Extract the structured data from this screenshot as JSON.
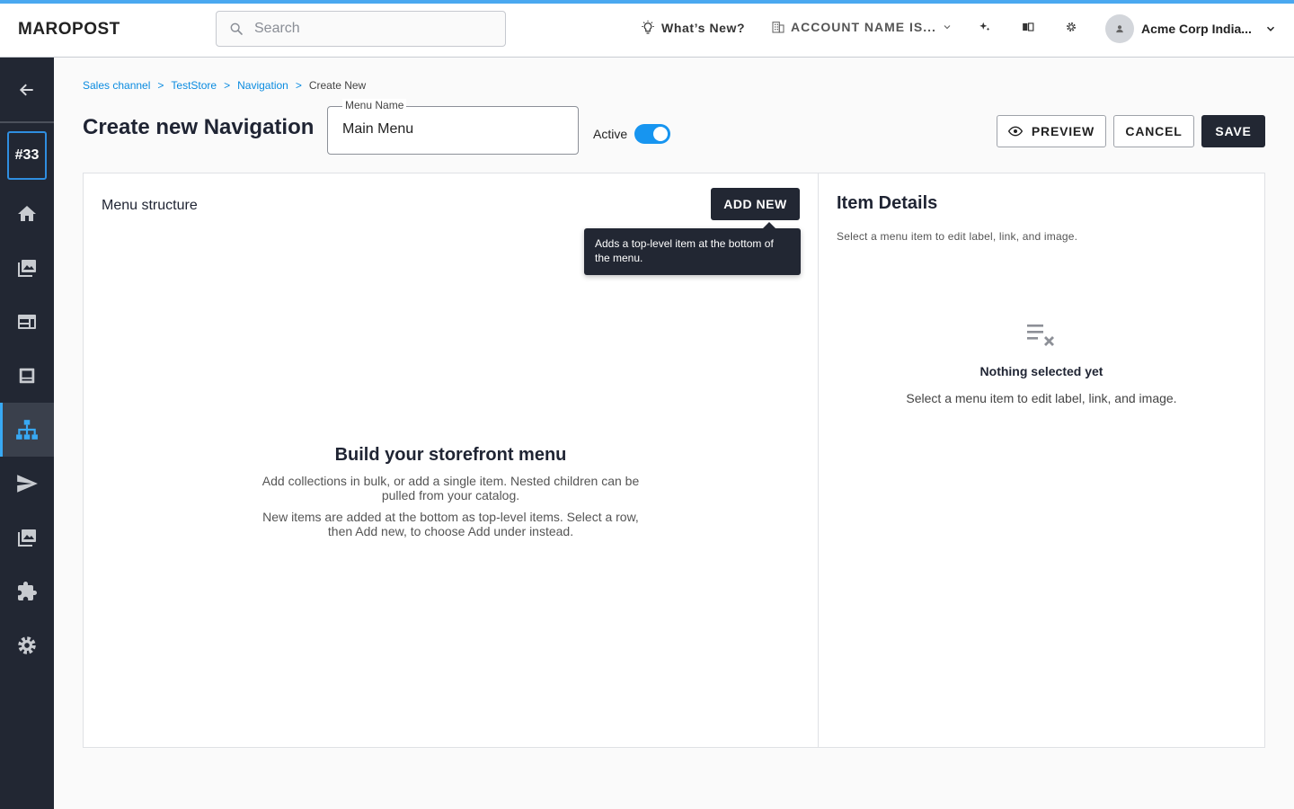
{
  "header": {
    "logo": "MAROPOST",
    "search_placeholder": "Search",
    "whats_new": "What’s New?",
    "account_name": "ACCOUNT NAME IS...",
    "user_name": "Acme Corp India..."
  },
  "sidebar": {
    "badge": "#33",
    "items": [
      {
        "icon": "home-icon"
      },
      {
        "icon": "gallery-icon"
      },
      {
        "icon": "web-icon"
      },
      {
        "icon": "list-icon"
      },
      {
        "icon": "sitemap-icon",
        "active": true
      },
      {
        "icon": "send-icon"
      },
      {
        "icon": "image-icon"
      },
      {
        "icon": "extension-icon"
      },
      {
        "icon": "settings-icon"
      }
    ]
  },
  "breadcrumb": {
    "items": [
      "Sales channel",
      "TestStore",
      "Navigation"
    ],
    "separator": ">",
    "current": "Create New"
  },
  "page": {
    "title": "Create new Navigation",
    "menu_name_label": "Menu Name",
    "menu_name_value": "Main Menu",
    "active_label": "Active",
    "active_on": true
  },
  "actions": {
    "preview": "PREVIEW",
    "cancel": "CANCEL",
    "save": "SAVE"
  },
  "menu_structure": {
    "title": "Menu structure",
    "add_new": "ADD NEW",
    "tooltip": "Adds a top-level item at the bottom of the menu.",
    "empty_title": "Build your storefront menu",
    "empty_text_1": "Add collections in bulk, or add a single item. Nested children can be pulled from your catalog.",
    "empty_text_2": "New items are added at the bottom as top-level items. Select a row, then Add new, to choose Add under instead."
  },
  "item_details": {
    "title": "Item Details",
    "subtitle": "Select a menu item to edit label, link, and image.",
    "empty_title": "Nothing selected yet",
    "empty_text": "Select a menu item to edit label, link, and image."
  },
  "colors": {
    "accent": "#1795f0",
    "sidebar_bg": "#222733",
    "link": "#0a8be0"
  }
}
